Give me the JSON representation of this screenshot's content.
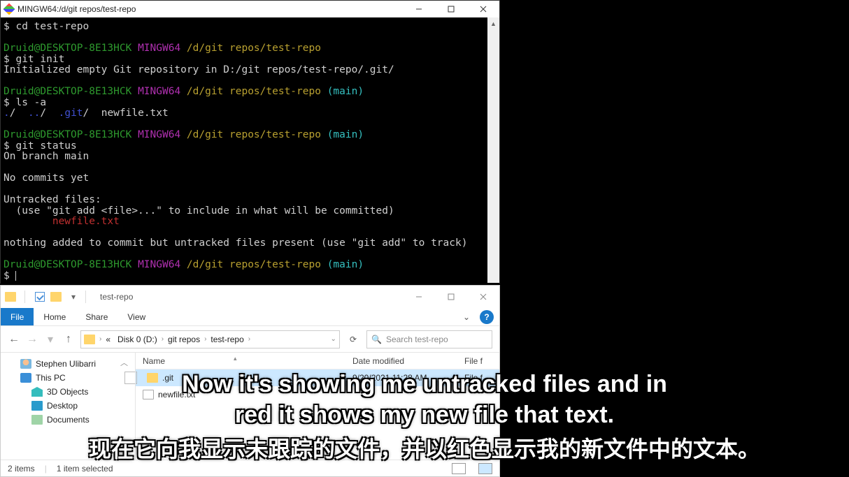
{
  "terminal": {
    "title": "MINGW64:/d/git repos/test-repo",
    "lines": [
      {
        "segs": [
          {
            "c": "c-white",
            "t": "$ cd test-repo"
          }
        ]
      },
      {
        "segs": []
      },
      {
        "segs": [
          {
            "c": "c-green",
            "t": "Druid@DESKTOP-8E13HCK"
          },
          {
            "c": "",
            "t": " "
          },
          {
            "c": "c-purple",
            "t": "MINGW64"
          },
          {
            "c": "",
            "t": " "
          },
          {
            "c": "c-yellow",
            "t": "/d/git repos/test-repo"
          }
        ]
      },
      {
        "segs": [
          {
            "c": "c-white",
            "t": "$ git init"
          }
        ]
      },
      {
        "segs": [
          {
            "c": "c-white",
            "t": "Initialized empty Git repository in D:/git repos/test-repo/.git/"
          }
        ]
      },
      {
        "segs": []
      },
      {
        "segs": [
          {
            "c": "c-green",
            "t": "Druid@DESKTOP-8E13HCK"
          },
          {
            "c": "",
            "t": " "
          },
          {
            "c": "c-purple",
            "t": "MINGW64"
          },
          {
            "c": "",
            "t": " "
          },
          {
            "c": "c-yellow",
            "t": "/d/git repos/test-repo"
          },
          {
            "c": "",
            "t": " "
          },
          {
            "c": "c-cyan",
            "t": "(main)"
          }
        ]
      },
      {
        "segs": [
          {
            "c": "c-white",
            "t": "$ ls -a"
          }
        ]
      },
      {
        "segs": [
          {
            "c": "c-blue",
            "t": "."
          },
          {
            "c": "c-white",
            "t": "/  "
          },
          {
            "c": "c-blue",
            "t": ".."
          },
          {
            "c": "c-white",
            "t": "/  "
          },
          {
            "c": "c-blue",
            "t": ".git"
          },
          {
            "c": "c-white",
            "t": "/  newfile.txt"
          }
        ]
      },
      {
        "segs": []
      },
      {
        "segs": [
          {
            "c": "c-green",
            "t": "Druid@DESKTOP-8E13HCK"
          },
          {
            "c": "",
            "t": " "
          },
          {
            "c": "c-purple",
            "t": "MINGW64"
          },
          {
            "c": "",
            "t": " "
          },
          {
            "c": "c-yellow",
            "t": "/d/git repos/test-repo"
          },
          {
            "c": "",
            "t": " "
          },
          {
            "c": "c-cyan",
            "t": "(main)"
          }
        ]
      },
      {
        "segs": [
          {
            "c": "c-white",
            "t": "$ git status"
          }
        ]
      },
      {
        "segs": [
          {
            "c": "c-white",
            "t": "On branch main"
          }
        ]
      },
      {
        "segs": []
      },
      {
        "segs": [
          {
            "c": "c-white",
            "t": "No commits yet"
          }
        ]
      },
      {
        "segs": []
      },
      {
        "segs": [
          {
            "c": "c-white",
            "t": "Untracked files:"
          }
        ]
      },
      {
        "segs": [
          {
            "c": "c-white",
            "t": "  (use \"git add <file>...\" to include in what will be committed)"
          }
        ]
      },
      {
        "segs": [
          {
            "c": "c-white",
            "t": "        "
          },
          {
            "c": "c-red",
            "t": "newfile.txt"
          }
        ]
      },
      {
        "segs": []
      },
      {
        "segs": [
          {
            "c": "c-white",
            "t": "nothing added to commit but untracked files present (use \"git add\" to track)"
          }
        ]
      },
      {
        "segs": []
      },
      {
        "segs": [
          {
            "c": "c-green",
            "t": "Druid@DESKTOP-8E13HCK"
          },
          {
            "c": "",
            "t": " "
          },
          {
            "c": "c-purple",
            "t": "MINGW64"
          },
          {
            "c": "",
            "t": " "
          },
          {
            "c": "c-yellow",
            "t": "/d/git repos/test-repo"
          },
          {
            "c": "",
            "t": " "
          },
          {
            "c": "c-cyan",
            "t": "(main)"
          }
        ]
      },
      {
        "segs": [
          {
            "c": "c-white",
            "t": "$ "
          }
        ],
        "cursor": true
      }
    ]
  },
  "explorer": {
    "title": "test-repo",
    "tabs": {
      "file": "File",
      "home": "Home",
      "share": "Share",
      "view": "View"
    },
    "breadcrumb": {
      "pre": "«",
      "parts": [
        "Disk 0 (D:)",
        "git repos",
        "test-repo"
      ]
    },
    "search_placeholder": "Search test-repo",
    "nav": [
      {
        "label": "Stephen Ulibarri",
        "icon": "user"
      },
      {
        "label": "This PC",
        "icon": "pc"
      },
      {
        "label": "3D Objects",
        "icon": "obj3d",
        "sub": true
      },
      {
        "label": "Desktop",
        "icon": "desktop",
        "sub": true
      },
      {
        "label": "Documents",
        "icon": "docs",
        "sub": true
      }
    ],
    "cols": {
      "name": "Name",
      "date": "Date modified",
      "type": "File f"
    },
    "rows": [
      {
        "name": ".git",
        "date": "9/20/2021 11:28 AM",
        "type": "File f",
        "icon": "folder",
        "selected": true
      },
      {
        "name": "newfile.txt",
        "date": "",
        "type": "",
        "icon": "txt",
        "selected": false
      }
    ],
    "status": {
      "items": "2 items",
      "selected": "1 item selected"
    }
  },
  "subtitle": {
    "en_line1": "Now it's showing me untracked files and in",
    "en_line2": "red it shows my new file that text.",
    "zh": "现在它向我显示未跟踪的文件，并以红色显示我的新文件中的文本。"
  }
}
